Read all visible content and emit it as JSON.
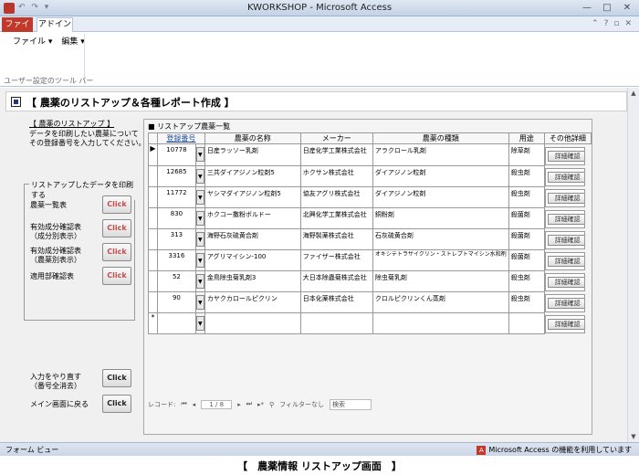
{
  "window": {
    "title": "KWORKSHOP - Microsoft Access"
  },
  "ribbon": {
    "tabs": [
      "ファイル",
      "アドイン"
    ],
    "menus": [
      "ファイル ▾",
      "編集 ▾"
    ],
    "group_label": "ユーザー設定のツール バー"
  },
  "form": {
    "title": "【 農薬のリストアップ＆各種レポート作成 】",
    "left": {
      "heading": "【 農薬のリストアップ 】",
      "desc": [
        "データを印刷したい農薬について",
        "その登録番号を入力してください。⇒"
      ],
      "print_group_title": "リストアップしたデータを印刷する",
      "rows": [
        {
          "label": "農薬一覧表",
          "label2": "",
          "button": "Click"
        },
        {
          "label": "有効成分確認表",
          "label2": "（成分別表示）",
          "button": "Click"
        },
        {
          "label": "有効成分確認表",
          "label2": "（農薬別表示）",
          "button": "Click"
        },
        {
          "label": "適用部確認表",
          "label2": "",
          "button": "Click"
        }
      ],
      "reset": {
        "label": "入力をやり直す",
        "label2": "（番号全消去）",
        "button": "Click"
      },
      "back": {
        "label": "メイン画面に戻る",
        "button": "Click"
      }
    },
    "main": {
      "title": "■ リストアップ農薬一覧",
      "columns": [
        "登録番号",
        "農薬の名称",
        "メーカー",
        "農薬の種類",
        "用途",
        "その他詳細"
      ],
      "rows": [
        {
          "num": "10778",
          "name": "日産ラッソー乳剤",
          "maker": "日産化学工業株式会社",
          "type": "アラクロール乳剤",
          "use": "除草剤",
          "selected": true
        },
        {
          "num": "12685",
          "name": "三共ダイアジノン粒剤5",
          "maker": "ホクサン株式会社",
          "type": "ダイアジノン粒剤",
          "use": "殺虫剤"
        },
        {
          "num": "11772",
          "name": "ヤシマダイアジノン粒剤5",
          "maker": "協友アグリ株式会社",
          "type": "ダイアジノン粒剤",
          "use": "殺虫剤"
        },
        {
          "num": "830",
          "name": "ホクコー撒粉ボルドー",
          "maker": "北興化学工業株式会社",
          "type": "銅粉剤",
          "use": "殺菌剤"
        },
        {
          "num": "313",
          "name": "海野石灰硫黄合剤",
          "maker": "海野製薬株式会社",
          "type": "石灰硫黄合剤",
          "use": "殺菌剤"
        },
        {
          "num": "3316",
          "name": "アグリマイシン-100",
          "maker": "ファイザー株式会社",
          "type": "オキシテトラサイクリン・ストレプトマイシン水和剤",
          "use": "殺菌剤"
        },
        {
          "num": "52",
          "name": "金鳥除虫菊乳剤3",
          "maker": "大日本除蟲菊株式会社",
          "type": "除虫菊乳剤",
          "use": "殺虫剤"
        },
        {
          "num": "90",
          "name": "カヤクカロールピクリン",
          "maker": "日本化薬株式会社",
          "type": "クロルピクリンくん蒸剤",
          "use": "殺虫剤"
        }
      ],
      "detail_button": "詳細確認",
      "new_row_marker": "*",
      "navigator": {
        "label": "レコード:",
        "position": "1 / 8",
        "filter": "フィルターなし",
        "search": "検索"
      }
    }
  },
  "status": {
    "left": "フォーム ビュー",
    "right": "Microsoft Access の機能を利用しています"
  },
  "caption": "【　農薬情報 リストアップ画面　】"
}
